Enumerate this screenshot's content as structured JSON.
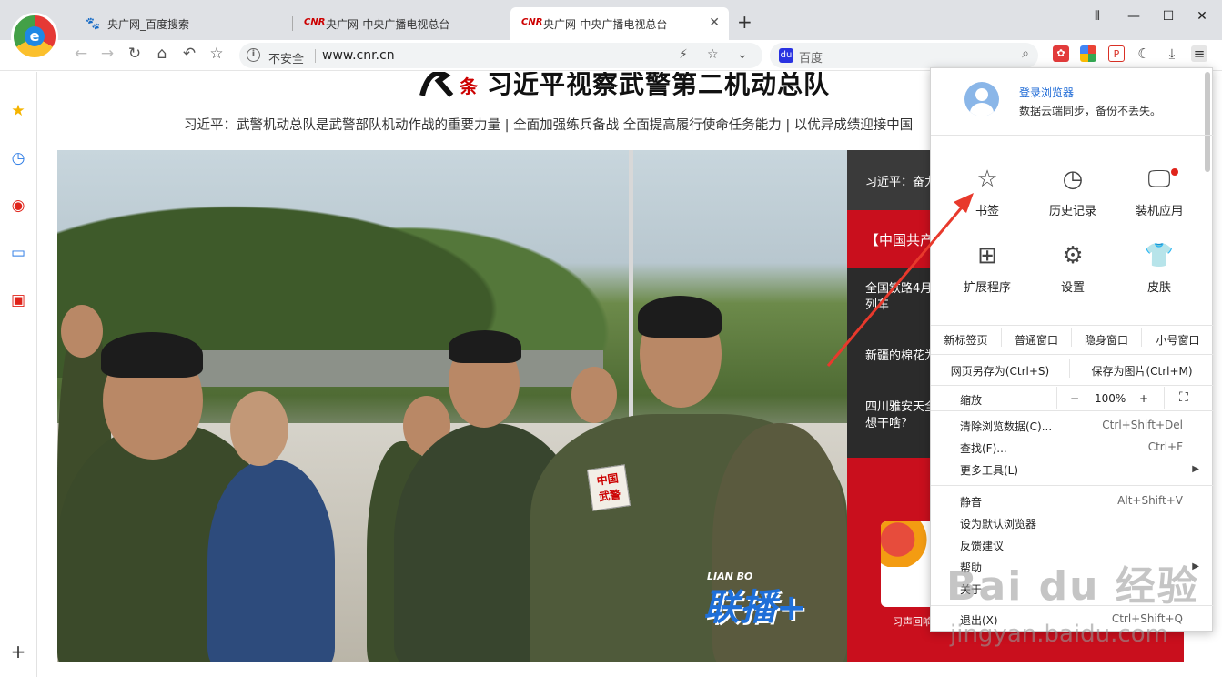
{
  "tabs": [
    {
      "favicon": "baidu-paw-icon",
      "title": "央广网_百度搜索",
      "active": false
    },
    {
      "favicon": "CNR",
      "title": "央广网-中央广播电视总台",
      "active": false
    },
    {
      "favicon": "CNR",
      "title": "央广网-中央广播电视总台",
      "active": true
    }
  ],
  "toolbar": {
    "security_label": "不安全",
    "url": "www.cnr.cn",
    "search_placeholder": "百度"
  },
  "page": {
    "headline": "习近平视察武警第二机动总队",
    "headline_badge": "条",
    "subline": "习近平：武警机动总队是武警部队机动作战的重要力量 | 全面加强练兵备战 全面提高履行使命任务能力 | 以优异成绩迎接中国",
    "patch_text": [
      "中国",
      "武警"
    ],
    "photo_watermark": "联播+",
    "photo_watermark_small": "LIAN BO",
    "right_column": {
      "top_item": "习近平：奋力",
      "red_item": "【中国共产",
      "items": [
        "全国铁路4月",
        "列车",
        "新疆的棉花为",
        "四川雅安天全",
        "想干啥?"
      ],
      "card_label": "习声回响"
    }
  },
  "menu": {
    "login_title": "登录浏览器",
    "login_subtitle": "数据云端同步，备份不丢失。",
    "grid": [
      {
        "icon": "star-icon",
        "label": "书签"
      },
      {
        "icon": "history-icon",
        "label": "历史记录"
      },
      {
        "icon": "monitor-icon",
        "label": "装机应用"
      },
      {
        "icon": "extensions-icon",
        "label": "扩展程序"
      },
      {
        "icon": "settings-gear-icon",
        "label": "设置"
      },
      {
        "icon": "tshirt-icon",
        "label": "皮肤"
      }
    ],
    "window_options": [
      "新标签页",
      "普通窗口",
      "隐身窗口",
      "小号窗口"
    ],
    "save_page": "网页另存为(Ctrl+S)",
    "save_image": "保存为图片(Ctrl+M)",
    "zoom_label": "缩放",
    "zoom_minus": "−",
    "zoom_value": "100%",
    "zoom_plus": "+",
    "items": [
      {
        "label": "清除浏览数据(C)...",
        "shortcut": "Ctrl+Shift+Del"
      },
      {
        "label": "查找(F)...",
        "shortcut": "Ctrl+F"
      },
      {
        "label": "更多工具(L)",
        "shortcut": ""
      },
      {
        "label": "静音",
        "shortcut": "Alt+Shift+V"
      },
      {
        "label": "设为默认浏览器",
        "shortcut": ""
      },
      {
        "label": "反馈建议",
        "shortcut": ""
      },
      {
        "label": "帮助",
        "shortcut": ""
      },
      {
        "label": "关于",
        "shortcut": ""
      },
      {
        "label": "退出(X)",
        "shortcut": "Ctrl+Shift+Q"
      }
    ]
  },
  "watermark": {
    "brand": "Bai du 经验",
    "url": "jingyan.baidu.com"
  },
  "colors": {
    "accent_red": "#c90f1d",
    "link_blue": "#1e6ad6",
    "arrow_red": "#e8392c"
  }
}
